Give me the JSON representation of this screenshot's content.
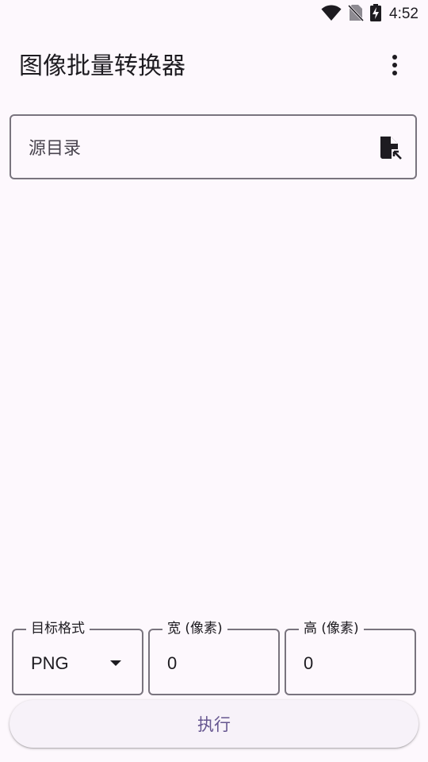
{
  "status_bar": {
    "time": "4:52",
    "icons": [
      "wifi-icon",
      "no-sim-icon",
      "battery-charging-icon"
    ]
  },
  "app_bar": {
    "title": "图像批量转换器",
    "overflow_icon": "more-vert-icon"
  },
  "source_directory": {
    "label": "源目录",
    "icon": "file-open-icon"
  },
  "settings": {
    "format": {
      "label": "目标格式",
      "value": "PNG"
    },
    "width": {
      "label": "宽 (像素)",
      "value": "0"
    },
    "height": {
      "label": "高 (像素)",
      "value": "0"
    }
  },
  "execute_button": {
    "label": "执行"
  },
  "colors": {
    "background": "#fdf8fd",
    "primary": "#65558f",
    "outline": "#79747e",
    "on_surface": "#1d1b20"
  }
}
